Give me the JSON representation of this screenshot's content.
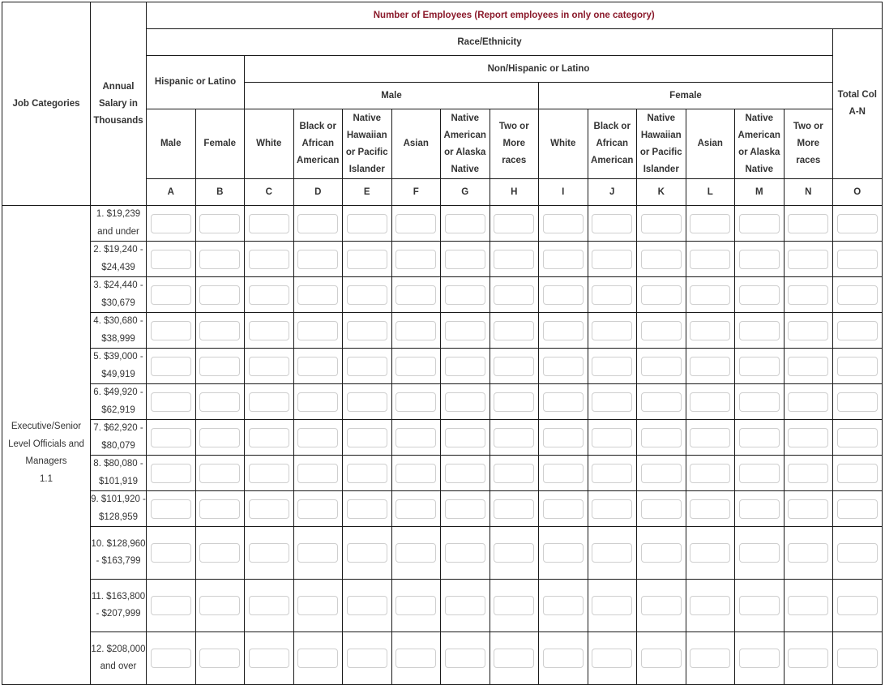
{
  "table": {
    "title": "Number of Employees (Report employees in only one category)",
    "job_categories_label": "Job Categories",
    "annual_salary_label": "Annual Salary in Thousands",
    "race_ethnicity_label": "Race/Ethnicity",
    "hispanic_label": "Hispanic or Latino",
    "non_hispanic_label": "Non/Hispanic or Latino",
    "male_group_label": "Male",
    "female_group_label": "Female",
    "total_label": "Total Col A-N",
    "columns": [
      {
        "letter": "A",
        "label": "Male"
      },
      {
        "letter": "B",
        "label": "Female"
      },
      {
        "letter": "C",
        "label": "White"
      },
      {
        "letter": "D",
        "label": "Black or African American"
      },
      {
        "letter": "E",
        "label": "Native Hawaiian or Pacific Islander"
      },
      {
        "letter": "F",
        "label": "Asian"
      },
      {
        "letter": "G",
        "label": "Native American or Alaska Native"
      },
      {
        "letter": "H",
        "label": "Two or More races"
      },
      {
        "letter": "I",
        "label": "White"
      },
      {
        "letter": "J",
        "label": "Black or African American"
      },
      {
        "letter": "K",
        "label": "Native Hawaiian or Pacific Islander"
      },
      {
        "letter": "L",
        "label": "Asian"
      },
      {
        "letter": "M",
        "label": "Native American or Alaska Native"
      },
      {
        "letter": "N",
        "label": "Two or More races"
      },
      {
        "letter": "O",
        "label": ""
      }
    ],
    "job_category": {
      "name": "Executive/Senior Level Officials and Managers",
      "code": "1.1"
    },
    "salary_bands": [
      "1. $19,239 and under",
      "2. $19,240 - $24,439",
      "3. $24,440 - $30,679",
      "4. $30,680 - $38,999",
      "5. $39,000 - $49,919",
      "6. $49,920 - $62,919",
      "7. $62,920 - $80,079",
      "8. $80,080 - $101,919",
      "9. $101,920 - $128,959",
      "10. $128,960 - $163,799",
      "11. $163,800 - $207,999",
      "12. $208,000 and over"
    ],
    "cell_values": [
      [
        "",
        "",
        "",
        "",
        "",
        "",
        "",
        "",
        "",
        "",
        "",
        "",
        "",
        "",
        ""
      ],
      [
        "",
        "",
        "",
        "",
        "",
        "",
        "",
        "",
        "",
        "",
        "",
        "",
        "",
        "",
        ""
      ],
      [
        "",
        "",
        "",
        "",
        "",
        "",
        "",
        "",
        "",
        "",
        "",
        "",
        "",
        "",
        ""
      ],
      [
        "",
        "",
        "",
        "",
        "",
        "",
        "",
        "",
        "",
        "",
        "",
        "",
        "",
        "",
        ""
      ],
      [
        "",
        "",
        "",
        "",
        "",
        "",
        "",
        "",
        "",
        "",
        "",
        "",
        "",
        "",
        ""
      ],
      [
        "",
        "",
        "",
        "",
        "",
        "",
        "",
        "",
        "",
        "",
        "",
        "",
        "",
        "",
        ""
      ],
      [
        "",
        "",
        "",
        "",
        "",
        "",
        "",
        "",
        "",
        "",
        "",
        "",
        "",
        "",
        ""
      ],
      [
        "",
        "",
        "",
        "",
        "",
        "",
        "",
        "",
        "",
        "",
        "",
        "",
        "",
        "",
        ""
      ],
      [
        "",
        "",
        "",
        "",
        "",
        "",
        "",
        "",
        "",
        "",
        "",
        "",
        "",
        "",
        ""
      ],
      [
        "",
        "",
        "",
        "",
        "",
        "",
        "",
        "",
        "",
        "",
        "",
        "",
        "",
        "",
        ""
      ],
      [
        "",
        "",
        "",
        "",
        "",
        "",
        "",
        "",
        "",
        "",
        "",
        "",
        "",
        "",
        ""
      ],
      [
        "",
        "",
        "",
        "",
        "",
        "",
        "",
        "",
        "",
        "",
        "",
        "",
        "",
        "",
        ""
      ]
    ]
  }
}
